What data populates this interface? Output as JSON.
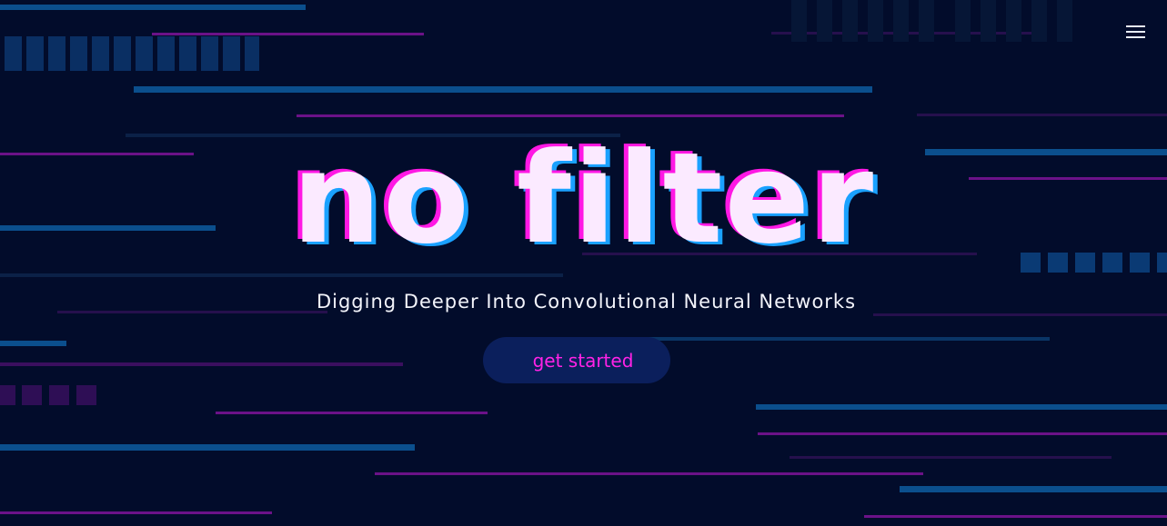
{
  "hero": {
    "title": "no filter",
    "subtitle": "Digging Deeper Into Convolutional Neural Networks",
    "cta_label": "get started"
  },
  "icons": {
    "menu": "hamburger-menu-icon"
  },
  "colors": {
    "background": "#020c2b",
    "accent_pink": "#ff18e4",
    "accent_blue": "#1aa1ff",
    "line_blue": "#0b4f8d",
    "line_purple": "#6b1288",
    "cta_background": "#0b1f5c"
  }
}
